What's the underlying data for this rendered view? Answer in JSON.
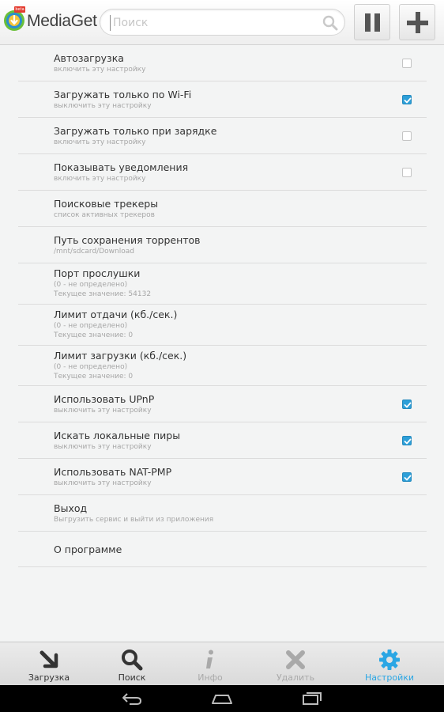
{
  "header": {
    "app_title": "MediaGet",
    "beta_badge": "beta",
    "search_placeholder": "Поиск",
    "search_value": "",
    "pause_icon": "pause-icon",
    "add_icon": "plus-icon"
  },
  "settings": [
    {
      "title": "Автозагрузка",
      "sub": [
        "включить эту настройку"
      ],
      "checkbox": true,
      "checked": false
    },
    {
      "title": "Загружать только по Wi-Fi",
      "sub": [
        "выключить эту настройку"
      ],
      "checkbox": true,
      "checked": true
    },
    {
      "title": "Загружать только при зарядке",
      "sub": [
        "включить эту настройку"
      ],
      "checkbox": true,
      "checked": false
    },
    {
      "title": "Показывать уведомления",
      "sub": [
        "включить эту настройку"
      ],
      "checkbox": true,
      "checked": false
    },
    {
      "title": "Поисковые трекеры",
      "sub": [
        "список активных трекеров"
      ],
      "checkbox": false
    },
    {
      "title": "Путь сохранения торрентов",
      "sub": [
        "/mnt/sdcard/Download"
      ],
      "checkbox": false
    },
    {
      "title": "Порт прослушки",
      "sub": [
        "(0 - не определено)",
        "Текущее значение: 54132"
      ],
      "checkbox": false
    },
    {
      "title": "Лимит отдачи (кб./сек.)",
      "sub": [
        "(0 - не определено)",
        "Текущее значение: 0"
      ],
      "checkbox": false
    },
    {
      "title": "Лимит загрузки (кб./сек.)",
      "sub": [
        "(0 - не определено)",
        "Текущее значение: 0"
      ],
      "checkbox": false
    },
    {
      "title": "Использовать UPnP",
      "sub": [
        "выключить эту настройку"
      ],
      "checkbox": true,
      "checked": true
    },
    {
      "title": "Искать локальные пиры",
      "sub": [
        "выключить эту настройку"
      ],
      "checkbox": true,
      "checked": true
    },
    {
      "title": "Использовать NAT-PMP",
      "sub": [
        "выключить эту настройку"
      ],
      "checkbox": true,
      "checked": true
    },
    {
      "title": "Выход",
      "sub": [
        "Выгрузить сервис и выйти из приложения"
      ],
      "checkbox": false
    },
    {
      "title": "О программе",
      "sub": [],
      "checkbox": false
    }
  ],
  "bottom_nav": [
    {
      "label": "Загрузка",
      "icon": "download-arrow-icon",
      "state": "normal"
    },
    {
      "label": "Поиск",
      "icon": "search-icon",
      "state": "normal"
    },
    {
      "label": "Инфо",
      "icon": "info-icon",
      "state": "disabled"
    },
    {
      "label": "Удалить",
      "icon": "delete-x-icon",
      "state": "disabled"
    },
    {
      "label": "Настройки",
      "icon": "gear-icon",
      "state": "active"
    }
  ],
  "colors": {
    "accent": "#2d9fd8",
    "active_tab": "#2aa6e4",
    "disabled_tab": "#a9a9a9",
    "normal_tab": "#333333"
  },
  "system_bar": [
    "back-icon",
    "home-icon",
    "recents-icon"
  ]
}
